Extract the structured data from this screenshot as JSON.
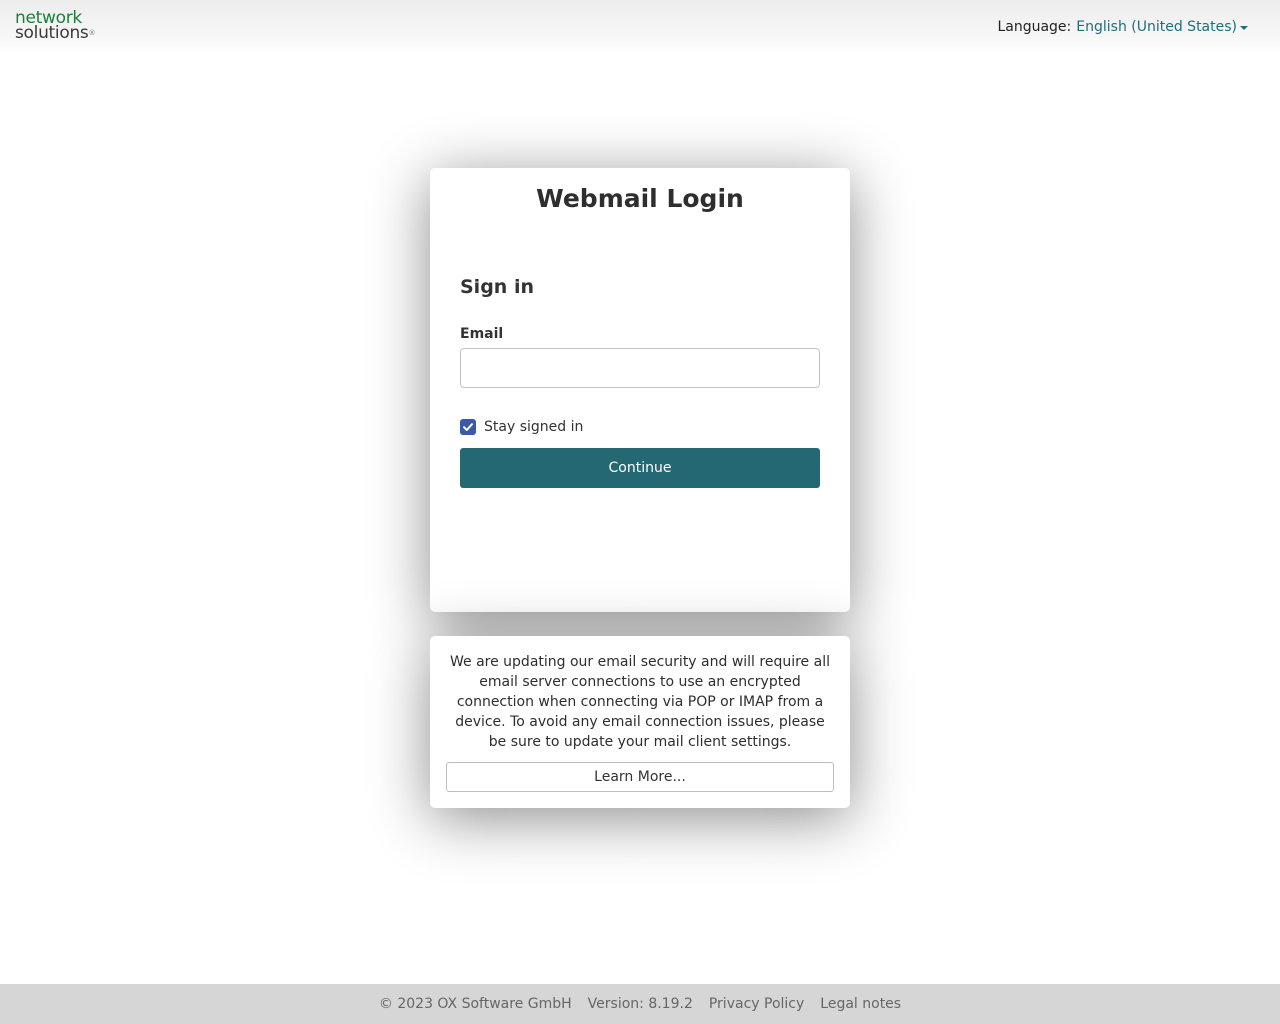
{
  "header": {
    "logo_line1": "network",
    "logo_line2": "solutions",
    "logo_reg": "®",
    "language_label": "Language:",
    "language_value": "English (United States)"
  },
  "login": {
    "title": "Webmail Login",
    "heading": "Sign in",
    "email_label": "Email",
    "email_value": "",
    "stay_signed_in_label": "Stay signed in",
    "stay_signed_in_checked": true,
    "continue_label": "Continue"
  },
  "notice": {
    "text": "We are updating our email security and will require all email server connections to use an encrypted connection when connecting via POP or IMAP from a device. To avoid any email connection issues, please be sure to update your mail client settings.",
    "learn_more_label": "Learn More..."
  },
  "footer": {
    "copyright": "© 2023 OX Software GmbH",
    "version": "Version: 8.19.2",
    "privacy": "Privacy Policy",
    "legal": "Legal notes"
  },
  "colors": {
    "accent": "#246873",
    "link": "#1f6e7a",
    "checkbox": "#3c58a8",
    "logo_green": "#1b7f3b"
  }
}
